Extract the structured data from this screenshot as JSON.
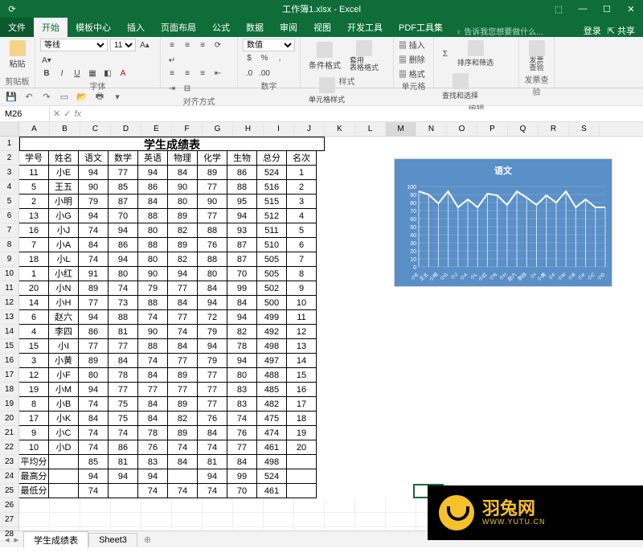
{
  "app": {
    "title": "工作簿1.xlsx - Excel"
  },
  "wincontrols": {
    "ribbonopts": "⬚",
    "min": "—",
    "max": "☐",
    "close": "✕"
  },
  "tabs": {
    "file": "文件",
    "items": [
      "开始",
      "模板中心",
      "插入",
      "页面布局",
      "公式",
      "数据",
      "审阅",
      "视图",
      "开发工具",
      "PDF工具集"
    ],
    "active": 0,
    "tell": "告诉我您想要做什么...",
    "signin": "登录",
    "share": "共享"
  },
  "ribbon": {
    "clipboard": {
      "label": "剪贴板",
      "paste": "粘贴"
    },
    "font": {
      "label": "字体",
      "name": "等线",
      "size": "11",
      "bold": "B",
      "italic": "I",
      "underline": "U"
    },
    "align": {
      "label": "对齐方式"
    },
    "number": {
      "label": "数字",
      "format": "数值"
    },
    "styles": {
      "label": "样式",
      "cond": "条件格式",
      "table": "套用\n表格格式",
      "cell": "单元格样式"
    },
    "cells": {
      "label": "单元格",
      "insert": "插入",
      "delete": "删除",
      "format": "格式"
    },
    "editing": {
      "label": "编辑",
      "sort": "排序和筛选",
      "find": "查找和选择"
    },
    "invoice": {
      "label": "发票查验",
      "btn": "发票\n查验"
    }
  },
  "namebox": "M26",
  "columns": [
    "A",
    "B",
    "C",
    "D",
    "E",
    "F",
    "G",
    "H",
    "I",
    "J",
    "K",
    "L",
    "M",
    "N",
    "O",
    "P",
    "Q",
    "R",
    "S"
  ],
  "sheet_title": "学生成绩表",
  "headers": [
    "学号",
    "姓名",
    "语文",
    "数学",
    "英语",
    "物理",
    "化学",
    "生物",
    "总分",
    "名次"
  ],
  "rows": [
    [
      "11",
      "小E",
      "94",
      "77",
      "94",
      "84",
      "89",
      "86",
      "524",
      "1"
    ],
    [
      "5",
      "王五",
      "90",
      "85",
      "86",
      "90",
      "77",
      "88",
      "516",
      "2"
    ],
    [
      "2",
      "小明",
      "79",
      "87",
      "84",
      "80",
      "90",
      "95",
      "515",
      "3"
    ],
    [
      "13",
      "小G",
      "94",
      "70",
      "88",
      "89",
      "77",
      "94",
      "512",
      "4"
    ],
    [
      "16",
      "小J",
      "74",
      "94",
      "80",
      "82",
      "88",
      "93",
      "511",
      "5"
    ],
    [
      "7",
      "小A",
      "84",
      "86",
      "88",
      "89",
      "76",
      "87",
      "510",
      "6"
    ],
    [
      "18",
      "小L",
      "74",
      "94",
      "80",
      "82",
      "88",
      "87",
      "505",
      "7"
    ],
    [
      "1",
      "小红",
      "91",
      "80",
      "90",
      "94",
      "80",
      "70",
      "505",
      "8"
    ],
    [
      "20",
      "小N",
      "89",
      "74",
      "79",
      "77",
      "84",
      "99",
      "502",
      "9"
    ],
    [
      "14",
      "小H",
      "77",
      "73",
      "88",
      "84",
      "94",
      "84",
      "500",
      "10"
    ],
    [
      "6",
      "赵六",
      "94",
      "88",
      "74",
      "77",
      "72",
      "94",
      "499",
      "11"
    ],
    [
      "4",
      "李四",
      "86",
      "81",
      "90",
      "74",
      "79",
      "82",
      "492",
      "12"
    ],
    [
      "15",
      "小I",
      "77",
      "77",
      "88",
      "84",
      "94",
      "78",
      "498",
      "13"
    ],
    [
      "3",
      "小黄",
      "89",
      "84",
      "74",
      "77",
      "79",
      "94",
      "497",
      "14"
    ],
    [
      "12",
      "小F",
      "80",
      "78",
      "84",
      "89",
      "77",
      "80",
      "488",
      "15"
    ],
    [
      "19",
      "小M",
      "94",
      "77",
      "77",
      "77",
      "77",
      "83",
      "485",
      "16"
    ],
    [
      "8",
      "小B",
      "74",
      "75",
      "84",
      "89",
      "77",
      "83",
      "482",
      "17"
    ],
    [
      "17",
      "小K",
      "84",
      "75",
      "84",
      "82",
      "76",
      "74",
      "475",
      "18"
    ],
    [
      "9",
      "小C",
      "74",
      "74",
      "78",
      "89",
      "84",
      "76",
      "474",
      "19"
    ],
    [
      "10",
      "小D",
      "74",
      "86",
      "76",
      "74",
      "74",
      "77",
      "461",
      "20"
    ]
  ],
  "summary": [
    [
      "平均分",
      "",
      "85",
      "81",
      "83",
      "84",
      "81",
      "84",
      "498",
      ""
    ],
    [
      "最高分",
      "",
      "94",
      "94",
      "94",
      "",
      "94",
      "99",
      "524",
      ""
    ],
    [
      "最低分",
      "",
      "74",
      "",
      "74",
      "74",
      "74",
      "70",
      "461",
      ""
    ]
  ],
  "chart_data": {
    "type": "line",
    "title": "语文",
    "ylim": [
      0,
      100
    ],
    "yticks": [
      0,
      10,
      20,
      30,
      40,
      50,
      60,
      70,
      80,
      90,
      100
    ],
    "categories": [
      "小E",
      "王五",
      "小明",
      "小G",
      "小J",
      "小A",
      "小L",
      "小红",
      "小N",
      "小H",
      "赵六",
      "李四",
      "小I",
      "小黄",
      "小F",
      "小M",
      "小B",
      "小K",
      "小C",
      "小D"
    ],
    "values": [
      94,
      90,
      79,
      94,
      74,
      84,
      74,
      91,
      89,
      77,
      94,
      86,
      77,
      89,
      80,
      94,
      74,
      84,
      74,
      74
    ]
  },
  "sheets": {
    "active": "学生成绩表",
    "tabs": [
      "学生成绩表",
      "Sheet3"
    ]
  },
  "watermark": {
    "name": "羽兔网",
    "url": "WWW.YUTU.CN"
  }
}
